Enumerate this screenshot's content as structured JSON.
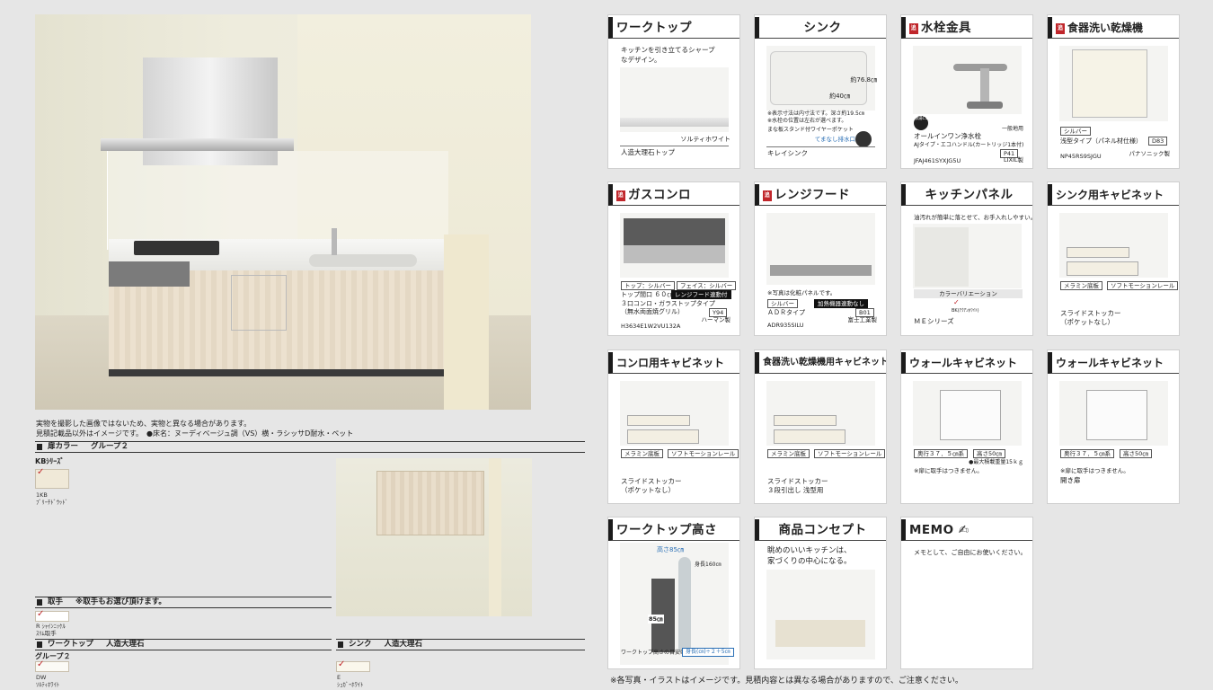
{
  "left": {
    "note1": "実物を撮影した画像ではないため、実物と異なる場合があります。",
    "note2": "見積記載品以外はイメージです。　●床名：ヌーディベージュ調（VS）横・ラシッサD耐水・ペット",
    "door_color": {
      "label": "扉カラー",
      "group": "グループ２",
      "series": "KBｼﾘｰｽﾞ",
      "code": "1KB",
      "name": "ﾌﾞﾘｰﾁﾄﾞｳｯﾄﾞ"
    },
    "handle": {
      "label": "取手",
      "note": "※取手もお選び頂けます。",
      "code": "R ｼｬｲﾝﾆｯｹﾙ",
      "name": "ｽﾘﾑ取手"
    },
    "worktop": {
      "label": "ワークトップ",
      "material": "人造大理石",
      "group": "グループ２",
      "code": "DW",
      "name": "ｿﾙﾃｨﾎﾜｲﾄ"
    },
    "sink": {
      "label": "シンク",
      "material": "人造大理石",
      "code": "E",
      "name": "ｼｭｶﾞｰﾎﾜｲﾄ"
    }
  },
  "cards": {
    "worktop": {
      "title": "ワークトップ",
      "desc1": "キッチンを引き立てるシャープ",
      "desc2": "なデザイン。",
      "color": "ソルティホワイト",
      "name": "人造大理石トップ"
    },
    "sink": {
      "title": "シンク",
      "dim1": "約76.8㎝",
      "dim2": "約40㎝",
      "note1": "※表示寸法は内寸法です。深さ約19.5㎝",
      "note2": "※水栓の位置は左右が選べます。",
      "note3": "まな板スタンド付ワイヤーポケット",
      "tag": "てまなし排水口",
      "name": "キレイシンク"
    },
    "faucet": {
      "title": "水栓金具",
      "badge": "節湯C1",
      "type": "一般地用",
      "name1": "オールインワン浄水栓",
      "name2": "AJタイプ・エコハンドル(カートリッジ1本付)",
      "code_tag": "P41",
      "code": "JFAJ461SYXJG5U",
      "maker": "LIXIL製"
    },
    "dishwasher": {
      "title": "食器洗い乾燥機",
      "color": "シルバー",
      "name": "浅型タイプ（パネル材仕様）",
      "code_tag": "D83",
      "code": "NP45RS9SJGU",
      "maker": "パナソニック製"
    },
    "gas": {
      "title": "ガスコンロ",
      "top": "トップ：シルバー",
      "face": "フェイス：シルバー",
      "size": "トップ間口 ６０㎝",
      "link": "レンジフード連動付",
      "name1": "３口コンロ・ガラストップタイプ",
      "name2": "（無水両面焼グリル）",
      "code_tag": "Y94",
      "code": "H3634E1W2VU132A",
      "maker": "ハーマン製"
    },
    "hood": {
      "title": "レンジフード",
      "note": "※写真は化粧パネルです。",
      "color": "シルバー",
      "link": "加熱機器連動なし",
      "name": "ＡＤＲタイプ",
      "code_tag": "B01",
      "code": "ADR935SILU",
      "maker": "富士工業製"
    },
    "panel": {
      "title": "キッチンパネル",
      "desc": "油汚れが簡単に落とせて、お手入れしやすい。",
      "variation": "カラーバリエーション",
      "swatch": "BK(ｱｸｱﾝﾎﾜｲﾄ)",
      "name": "ＭＥシリーズ"
    },
    "sink_cab": {
      "title": "シンク用キャビネット",
      "tag1": "メラミン底板",
      "tag2": "ソフトモーションレール",
      "name1": "スライドストッカー",
      "name2": "（ポケットなし）"
    },
    "stove_cab": {
      "title": "コンロ用キャビネット",
      "tag1": "メラミン底板",
      "tag2": "ソフトモーションレール",
      "name1": "スライドストッカー",
      "name2": "（ポケットなし）"
    },
    "dish_cab": {
      "title": "食器洗い乾燥機用キャビネット",
      "tag1": "メラミン底板",
      "tag2": "ソフトモーションレール",
      "name1": "スライドストッカー",
      "name2": "３段引出し 浅型用"
    },
    "wall_cab1": {
      "title": "ウォールキャビネット",
      "tag1": "奥行３７．５㎝系",
      "tag2": "高さ50㎝",
      "load": "●最大積載重量15ｋｇ",
      "note": "※扉に取手はつきません。"
    },
    "wall_cab2": {
      "title": "ウォールキャビネット",
      "tag1": "奥行３７．５㎝系",
      "tag2": "高さ50㎝",
      "note": "※扉に取手はつきません。",
      "name": "開き扉"
    },
    "height": {
      "title": "ワークトップ高さ",
      "height": "高さ85㎝",
      "body": "身長160㎝",
      "unit": "85㎝",
      "guide": "ワークトップ高さの目安は",
      "formula": "身長(㎝)÷２＋5㎝"
    },
    "concept": {
      "title": "商品コンセプト",
      "line1": "眺めのいいキッチンは、",
      "line2": "家づくりの中心になる。"
    },
    "memo": {
      "title": "MEMO",
      "text": "メモとして、ご自由にお使いください。"
    }
  },
  "footer": "※各写真・イラストはイメージです。見積内容とは異なる場合がありますので、ご注意ください。"
}
